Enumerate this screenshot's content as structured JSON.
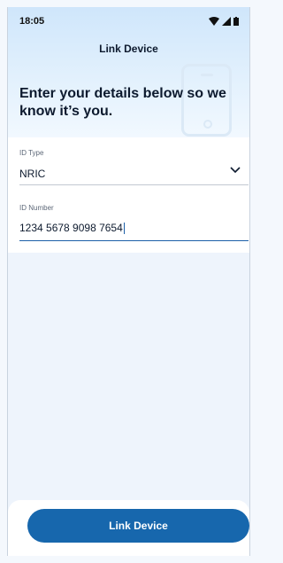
{
  "status_bar": {
    "time": "18:05",
    "icons": [
      "wifi-icon",
      "signal-icon",
      "battery-icon"
    ]
  },
  "header": {
    "title": "Link Device"
  },
  "intro": {
    "text": "Enter your details below so we know it’s you."
  },
  "form": {
    "id_type": {
      "label": "ID Type",
      "value": "NRIC"
    },
    "id_number": {
      "label": "ID Number",
      "value": "1234 5678 9098 7654"
    }
  },
  "footer": {
    "button_label": "Link Device"
  },
  "colors": {
    "accent": "#1767ad",
    "header_bg": "#cfe6fb"
  }
}
